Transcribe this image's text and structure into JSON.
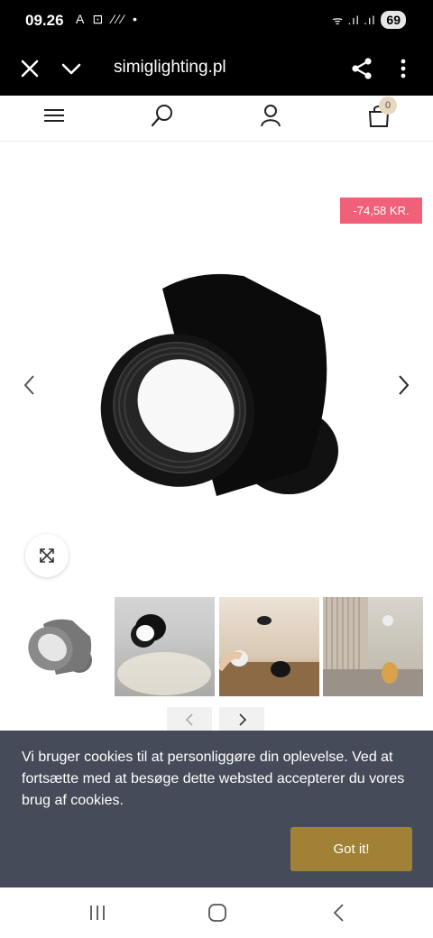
{
  "status_bar": {
    "time": "09.26",
    "left_icons": "A ⊡ ⁄⁄⁄ •",
    "signal": "ᯤ .ıl .ıl",
    "battery": "69"
  },
  "browser": {
    "url": "simiglighting.pl"
  },
  "header": {
    "cart_count": "0"
  },
  "product": {
    "discount_badge": "-74,58 KR."
  },
  "cookie_banner": {
    "message": "Vi bruger cookies til at personliggøre din oplevelse. Ved at fortsætte med at besøge dette websted accepterer du vores brug af cookies.",
    "button_label": "Got it!"
  },
  "colors": {
    "sale_badge": "#f06078",
    "cookie_bg": "#454b58",
    "accept_button": "#a08135"
  }
}
